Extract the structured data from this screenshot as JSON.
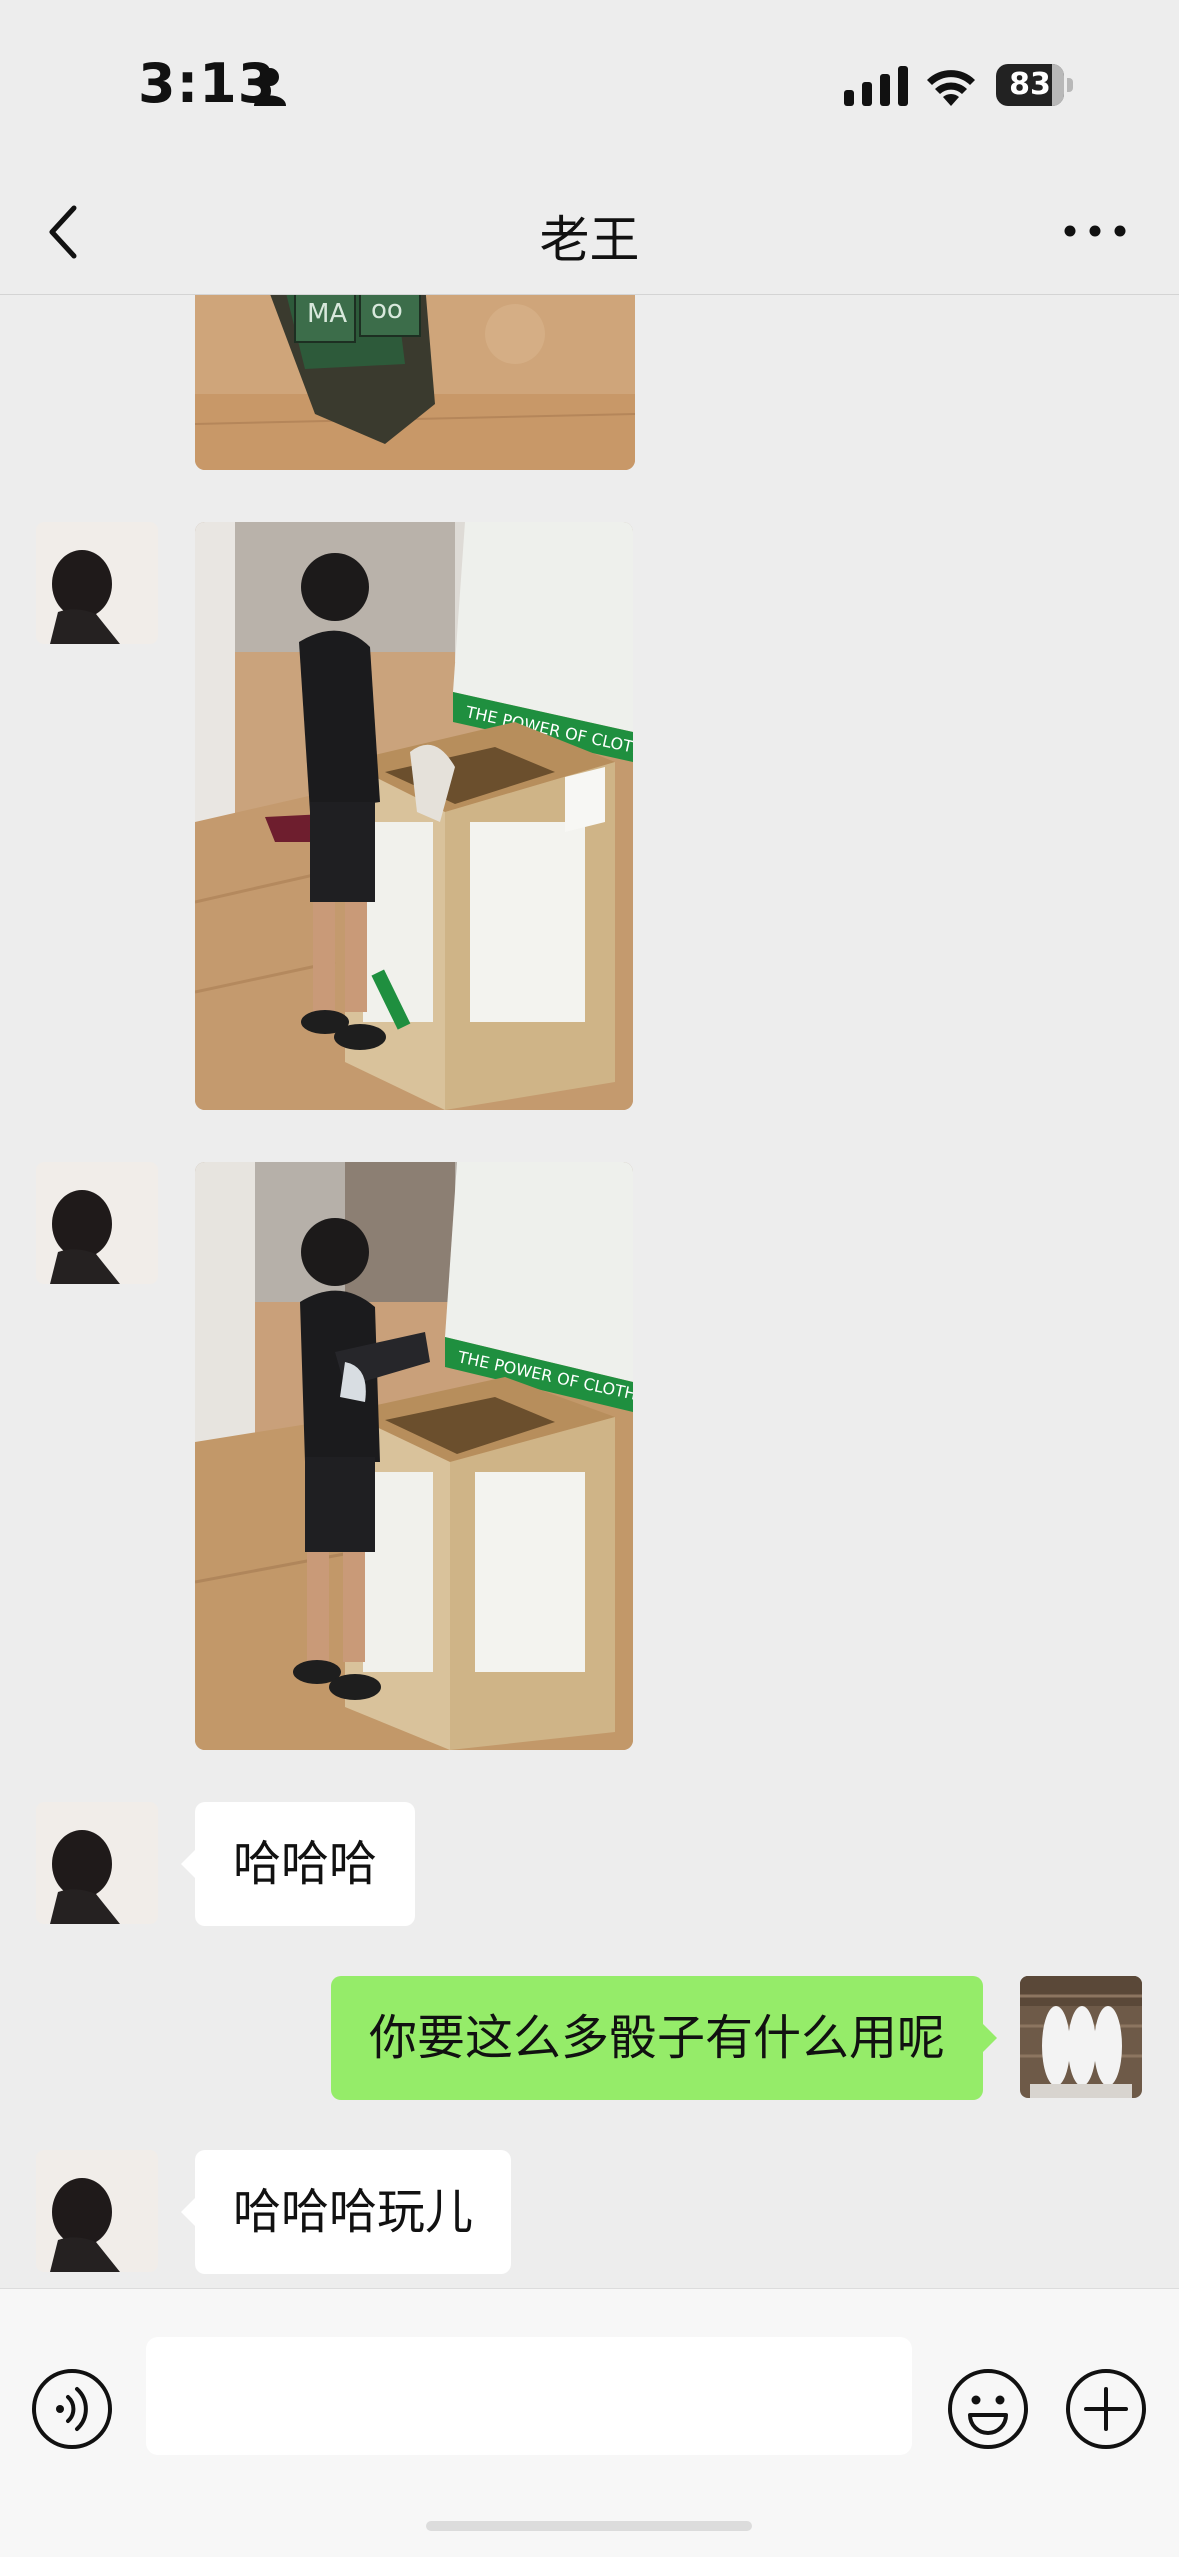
{
  "status_bar": {
    "time": "3:13",
    "battery_level": "83",
    "battery_fraction": 0.83
  },
  "nav": {
    "title": "老王"
  },
  "messages": {
    "m4_text": "哈哈哈",
    "m5_text": "你要这么多骰子有什么用呢",
    "m6_text": "哈哈哈玩儿"
  },
  "input_bar": {
    "placeholder": ""
  },
  "icons": {
    "back": "chevron-left-icon",
    "more": "ellipsis-icon",
    "voice": "voice-icon",
    "emoji": "emoji-icon",
    "plus": "plus-icon"
  },
  "colors": {
    "background": "#ededed",
    "outgoing_bubble": "#95ec69",
    "incoming_bubble": "#ffffff",
    "box_green": "#1f8f3f"
  }
}
